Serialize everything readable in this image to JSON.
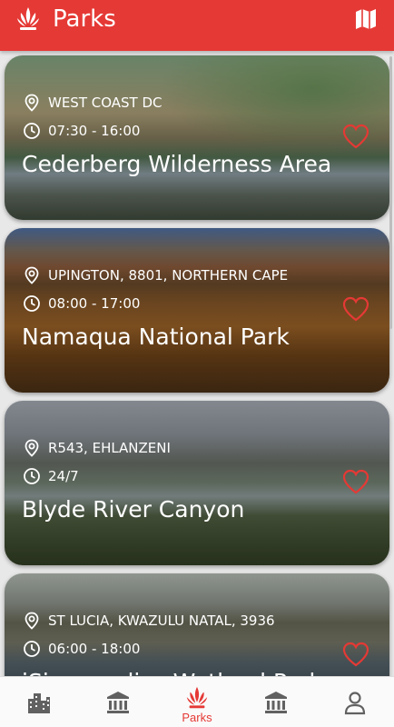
{
  "app": {
    "title": "Parks",
    "accent": "#e53935"
  },
  "appbar": {
    "logo_icon": "protea-logo-icon",
    "map_icon": "map-icon"
  },
  "parks": [
    {
      "location": "WEST COAST DC",
      "hours": "07:30 - 16:00",
      "name": "Cederberg Wilderness Area",
      "favorite": false
    },
    {
      "location": "UPINGTON, 8801, NORTHERN CAPE",
      "hours": "08:00 - 17:00",
      "name": "Namaqua National Park",
      "favorite": false
    },
    {
      "location": "R543, EHLANZENI",
      "hours": "24/7",
      "name": "Blyde River Canyon",
      "favorite": false
    },
    {
      "location": "ST LUCIA, KWAZULU NATAL, 3936",
      "hours": "06:00 - 18:00",
      "name": "iSimangaliso Wetland Park",
      "favorite": false
    }
  ],
  "bottom_nav": [
    {
      "icon": "city-icon",
      "label": ""
    },
    {
      "icon": "museum-icon",
      "label": ""
    },
    {
      "icon": "protea-icon",
      "label": "Parks",
      "active": true
    },
    {
      "icon": "bank-icon",
      "label": ""
    },
    {
      "icon": "person-icon",
      "label": ""
    }
  ]
}
